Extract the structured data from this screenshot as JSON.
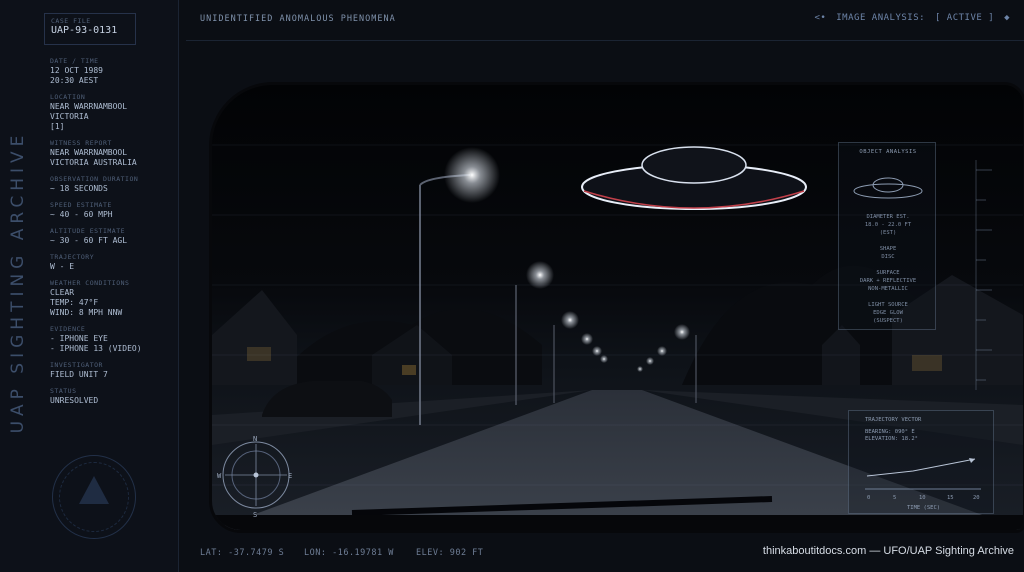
{
  "side": {
    "vertical_title": "UAP SIGHTING ARCHIVE",
    "case_label": "CASE FILE",
    "case_id": "UAP-93-0131",
    "fields": [
      {
        "label": "DATE / TIME",
        "lines": [
          "12 OCT 1989",
          "20:30 AEST"
        ]
      },
      {
        "label": "LOCATION",
        "lines": [
          "NEAR WARRNAMBOOL",
          "VICTORIA",
          "[1]"
        ]
      },
      {
        "label": "WITNESS REPORT",
        "lines": [
          "NEAR WARRNAMBOOL",
          "VICTORIA AUSTRALIA"
        ]
      },
      {
        "label": "OBSERVATION DURATION",
        "lines": [
          "~ 18 SECONDS"
        ]
      },
      {
        "label": "SPEED ESTIMATE",
        "lines": [
          "~ 40 - 60 MPH"
        ]
      },
      {
        "label": "ALTITUDE ESTIMATE",
        "lines": [
          "~ 30 - 60 FT AGL"
        ]
      },
      {
        "label": "TRAJECTORY",
        "lines": [
          "W - E"
        ]
      },
      {
        "label": "WEATHER CONDITIONS",
        "lines": [
          "CLEAR",
          "TEMP: 47°F",
          "WIND: 8 MPH NNW"
        ]
      },
      {
        "label": "EVIDENCE",
        "lines": [
          "- IPHONE EYE",
          "- IPHONE 13 (VIDEO)"
        ]
      },
      {
        "label": "INVESTIGATOR",
        "lines": [
          "FIELD UNIT 7"
        ]
      },
      {
        "label": "STATUS",
        "lines": [
          "UNRESOLVED"
        ]
      }
    ]
  },
  "top": {
    "title": "UNIDENTIFIED ANOMALOUS PHENOMENA",
    "status_prefix": "IMAGE ANALYSIS:",
    "status_value": "[ ACTIVE ]"
  },
  "analysis_panel": {
    "title": "OBJECT ANALYSIS",
    "lines": [
      "DIAMETER EST.",
      "18.0 - 22.0 FT",
      "(EST)",
      "",
      "SHAPE",
      "DISC",
      "",
      "SURFACE",
      "DARK + REFLECTIVE",
      "NON-METALLIC",
      "",
      "LIGHT SOURCE",
      "EDGE GLOW",
      "(SUSPECT)"
    ]
  },
  "trajectory_panel": {
    "title": "TRAJECTORY VECTOR",
    "lines": [
      "BEARING: 090° E",
      "ELEVATION: 18.2°"
    ],
    "axis_ticks": [
      "0",
      "5",
      "10",
      "15",
      "20"
    ],
    "footer": "TIME (SEC)"
  },
  "compass": {
    "n": "N",
    "s": "S",
    "e": "E",
    "w": "W"
  },
  "bottom": {
    "lat": "LAT: -37.7479  S",
    "lon": "LON: -16.19781  W",
    "elev": "ELEV: 902 FT",
    "credit": "thinkaboutitdocs.com — UFO/UAP Sighting Archive"
  },
  "colors": {
    "accent": "#6d84a8",
    "background": "#0b0e14",
    "ufo_glow": "#e8eef8",
    "ufo_rim": "#c0404a"
  }
}
